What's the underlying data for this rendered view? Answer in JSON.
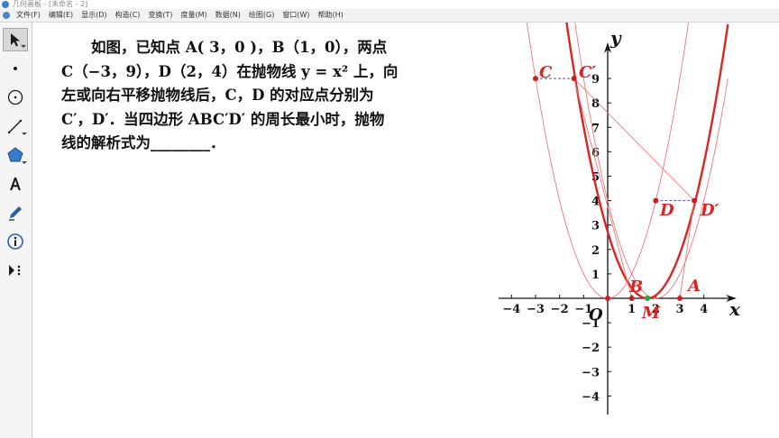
{
  "window": {
    "title": "几何画板 - [未命名 - 2]"
  },
  "menu": [
    "文件(F)",
    "编辑(E)",
    "显示(D)",
    "构造(C)",
    "变换(T)",
    "度量(M)",
    "数据(N)",
    "绘图(G)",
    "窗口(W)",
    "帮助(H)"
  ],
  "tools": [
    "arrow-icon",
    "point-icon",
    "compass-icon",
    "line-icon",
    "polygon-icon",
    "text-icon",
    "marker-icon",
    "info-icon",
    "custom-tools-icon"
  ],
  "problem": {
    "lines": [
      "如图，已知点 A( 3，0 )，B（1，0），两点",
      "C（−3，9），D（2，4）在抛物线 y = x² 上，向",
      "左或向右平移抛物线后，C，D 的对应点分别为",
      "C′，D′．当四边形 ABC′D′ 的周长最小时，抛物",
      "线的解析式为________．"
    ]
  },
  "graph": {
    "axis_x_label": "x",
    "axis_y_label": "y",
    "origin_label": "O",
    "x_ticks": [
      "−4",
      "−3",
      "−2",
      "−1",
      "1",
      "2",
      "3",
      "4"
    ],
    "y_ticks": [
      "9",
      "8",
      "7",
      "6",
      "5",
      "4",
      "3",
      "2",
      "1",
      "−1",
      "−2",
      "−3",
      "−4"
    ],
    "point_labels": {
      "A": "A",
      "B": "B",
      "C": "C",
      "C_prime": "C′",
      "D": "D",
      "D_prime": "D′",
      "M": "M"
    },
    "colors": {
      "curve": "#dd2222",
      "thin_curve": "#ee7777",
      "point": "#c82020",
      "point_m": "#22aa33",
      "dash": "#5555aa",
      "label": "#dd2222"
    }
  }
}
